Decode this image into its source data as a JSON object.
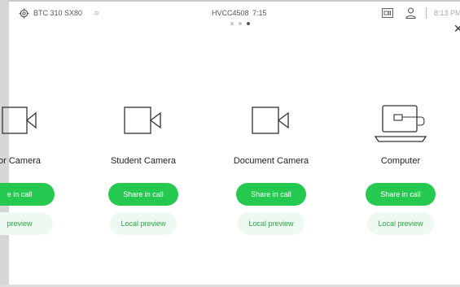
{
  "status_bar": {
    "device_name": "BTC 310 SX80",
    "room_id": "HVCC4508",
    "room_time": "7:15",
    "clock": "8:13 PM"
  },
  "pager": {
    "pages": 3,
    "active_index": 2
  },
  "sources": [
    {
      "label": "or Camera",
      "icon": "camera-icon",
      "share_label": "e in call",
      "preview_label": "preview"
    },
    {
      "label": "Student Camera",
      "icon": "camera-icon",
      "share_label": "Share in call",
      "preview_label": "Local preview"
    },
    {
      "label": "Document Camera",
      "icon": "camera-icon",
      "share_label": "Share in call",
      "preview_label": "Local preview"
    },
    {
      "label": "Computer",
      "icon": "laptop-icon",
      "share_label": "Share in call",
      "preview_label": "Local preview"
    }
  ],
  "colors": {
    "accent": "#26c94f",
    "preview_bg": "#eefaf1",
    "preview_text": "#2aa548"
  }
}
